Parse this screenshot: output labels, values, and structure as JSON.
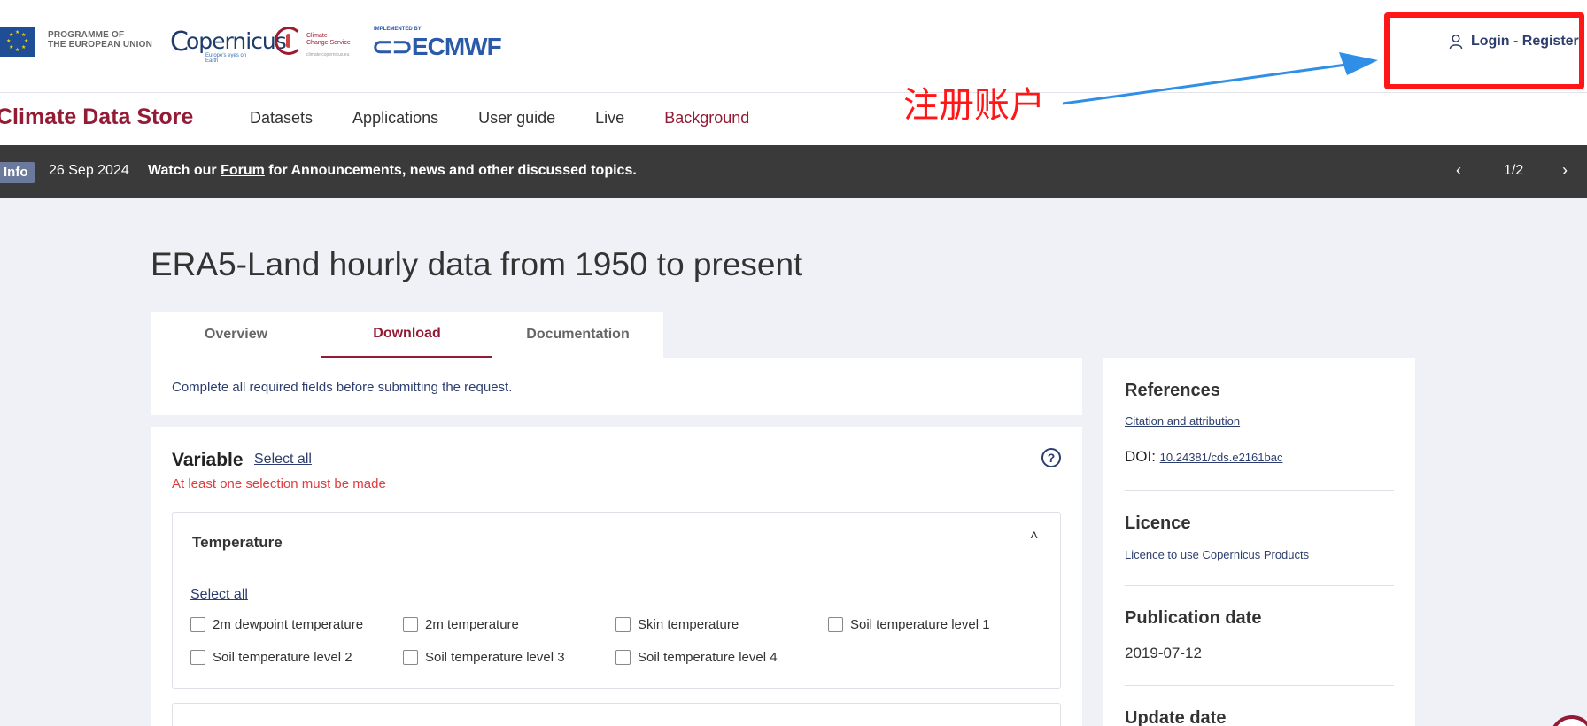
{
  "header": {
    "programme_line1": "PROGRAMME OF",
    "programme_line2": "THE EUROPEAN UNION",
    "copernicus": "opernicus",
    "copernicus_sub": "Europe's eyes on Earth",
    "c3s_line1": "Climate",
    "c3s_line2": "Change Service",
    "c3s_url": "climate.copernicus.eu",
    "ecmwf_implemented": "IMPLEMENTED BY",
    "ecmwf_logo": "ECMWF",
    "login_label": "Login - Register"
  },
  "annotation": {
    "text": "注册账户"
  },
  "nav": {
    "brand": "Climate Data Store",
    "items": [
      "Datasets",
      "Applications",
      "User guide",
      "Live",
      "Background"
    ]
  },
  "infobar": {
    "badge": "Info",
    "date": "26 Sep 2024",
    "text_before": "Watch our ",
    "link": "Forum",
    "text_after": " for Announcements, news and other discussed topics.",
    "prev": "‹",
    "page": "1/2",
    "next": "›"
  },
  "main": {
    "title": "ERA5-Land hourly data from 1950 to present",
    "tabs": [
      "Overview",
      "Download",
      "Documentation"
    ],
    "notice": "Complete all required fields before submitting the request.",
    "variable": {
      "title": "Variable",
      "select_all": "Select all",
      "help": "?",
      "error": "At least one selection must be made",
      "temperature": {
        "title": "Temperature",
        "chevron": "˄",
        "select_all": "Select all",
        "row1": [
          "2m dewpoint temperature",
          "2m temperature",
          "Skin temperature",
          "Soil temperature level 1"
        ],
        "row2": [
          "Soil temperature level 2",
          "Soil temperature level 3",
          "Soil temperature level 4"
        ]
      }
    }
  },
  "sidebar": {
    "references_title": "References",
    "citation_link": "Citation and attribution",
    "doi_label": "DOI: ",
    "doi_value": "10.24381/cds.e2161bac",
    "licence_title": "Licence",
    "licence_link": "Licence to use Copernicus Products",
    "publication_title": "Publication date",
    "publication_value": "2019-07-12",
    "update_title": "Update date"
  },
  "colors": {
    "accent": "#941b35",
    "link": "#2d3e6e",
    "error": "#e03c3c",
    "annotation": "#ff1616"
  }
}
